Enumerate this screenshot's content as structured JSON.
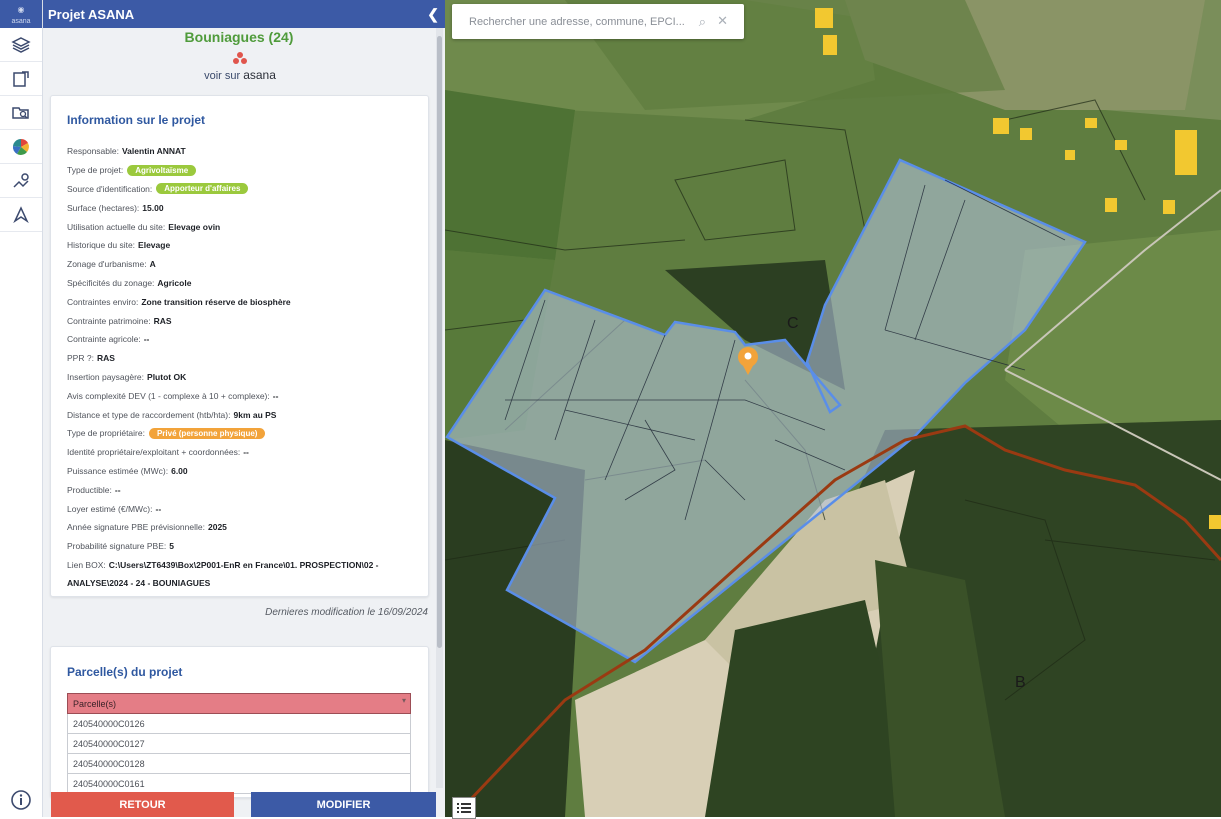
{
  "app": {
    "logo_text": "asana",
    "panel_title": "Projet ASANA",
    "collapse_icon": "chevron-left-icon"
  },
  "rail": {
    "items": [
      {
        "icon": "layers-icon"
      },
      {
        "icon": "document-edit-icon"
      },
      {
        "icon": "folder-search-icon"
      },
      {
        "icon": "color-wheel-icon"
      },
      {
        "icon": "route-pin-icon"
      },
      {
        "icon": "navigation-arrow-icon"
      }
    ],
    "info_icon": "info-icon"
  },
  "project": {
    "title": "Bouniagues (24)",
    "asana_link_prefix": "voir sur",
    "asana_link_brand": "asana"
  },
  "info": {
    "heading": "Information sur le projet",
    "rows": [
      {
        "label": "Responsable:",
        "value": "Valentin ANNAT"
      },
      {
        "label": "Type de projet:",
        "badge": "Agrivoltaïsme",
        "badge_color": "#9bc93d"
      },
      {
        "label": "Source d'identification:",
        "badge": "Apporteur d'affaires",
        "badge_color": "#9bc93d"
      },
      {
        "label": "Surface (hectares):",
        "value": "15.00"
      },
      {
        "label": "Utilisation actuelle du site:",
        "value": "Elevage ovin"
      },
      {
        "label": "Historique du site:",
        "value": "Elevage"
      },
      {
        "label": "Zonage d'urbanisme:",
        "value": "A"
      },
      {
        "label": "Spécificités du zonage:",
        "value": "Agricole"
      },
      {
        "label": "Contraintes enviro:",
        "value": "Zone transition réserve de biosphère"
      },
      {
        "label": "Contrainte patrimoine:",
        "value": "RAS"
      },
      {
        "label": "Contrainte agricole:",
        "value": "--"
      },
      {
        "label": "PPR ?:",
        "value": "RAS"
      },
      {
        "label": "Insertion paysagère:",
        "value": "Plutot OK"
      },
      {
        "label": "Avis complexité DEV (1 - complexe à 10 + complexe):",
        "value": "--"
      },
      {
        "label": "Distance et type de raccordement (htb/hta):",
        "value": "9km au PS"
      },
      {
        "label": "Type de propriétaire:",
        "badge": "Privé (personne physique)",
        "badge_color": "#f2a33a"
      },
      {
        "label": "Identité propriétaire/exploitant + coordonnées:",
        "value": "--"
      },
      {
        "label": "Puissance estimée (MWc):",
        "value": "6.00"
      },
      {
        "label": "Productible:",
        "value": "--"
      },
      {
        "label": "Loyer estimé (€/MWc):",
        "value": "--"
      },
      {
        "label": "Année signature PBE prévisionnelle:",
        "value": "2025"
      },
      {
        "label": "Probabilité signature PBE:",
        "value": "5"
      },
      {
        "label": "Lien BOX:",
        "value": "C:\\Users\\ZT6439\\Box\\2P001-EnR en France\\01. PROSPECTION\\02 - ANALYSE\\2024 - 24 - BOUNIAGUES"
      }
    ],
    "last_modified": "Dernieres modification le 16/09/2024"
  },
  "parcels": {
    "heading": "Parcelle(s) du projet",
    "column": "Parcelle(s)",
    "rows": [
      "240540000C0126",
      "240540000C0127",
      "240540000C0128",
      "240540000C0161"
    ]
  },
  "buttons": {
    "back": "RETOUR",
    "edit": "MODIFIER"
  },
  "map": {
    "search_placeholder": "Rechercher une adresse, commune, EPCI...",
    "labels": [
      "C",
      "B"
    ],
    "polygon_color": "#5a8ee8",
    "line_color": "#9a3a12",
    "marker_color": "#f2a33a"
  }
}
